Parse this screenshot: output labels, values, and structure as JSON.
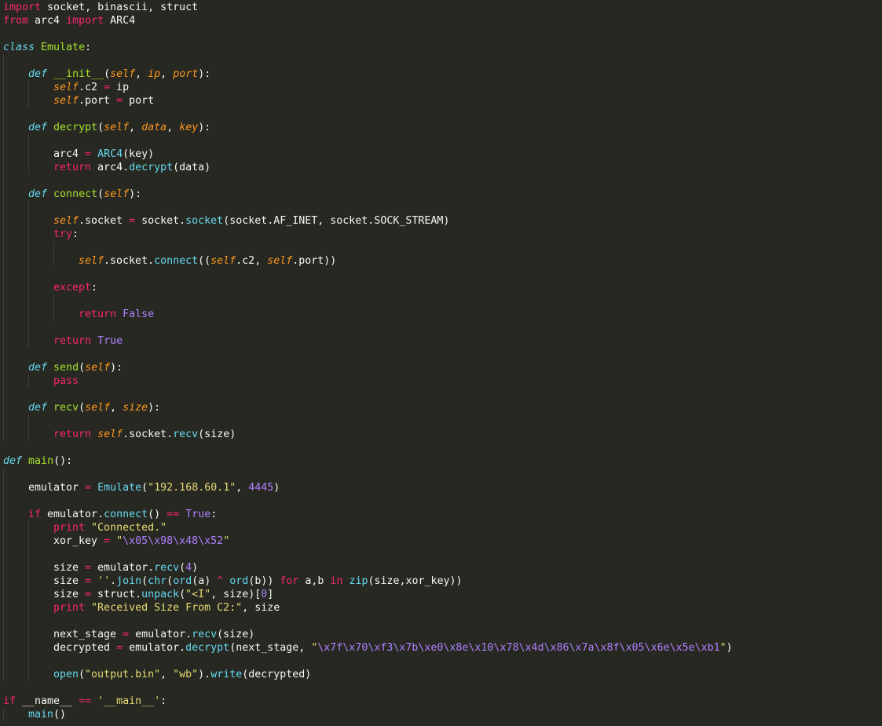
{
  "editor": {
    "theme": "monokai",
    "colors": {
      "background": "#272822",
      "foreground": "#f8f8f2",
      "keyword": "#f92672",
      "storage": "#66d9ef",
      "function": "#a6e22e",
      "parameter": "#fd971f",
      "string": "#e6db74",
      "constant": "#ae81ff",
      "indent_guide": "#3e3d32"
    },
    "lines": [
      {
        "indent": 0,
        "tokens": [
          [
            "keyword",
            "import"
          ],
          [
            "plain",
            " socket, binascii, struct"
          ]
        ]
      },
      {
        "indent": 0,
        "tokens": [
          [
            "keyword",
            "from"
          ],
          [
            "plain",
            " arc4 "
          ],
          [
            "keyword",
            "import"
          ],
          [
            "plain",
            " ARC4"
          ]
        ]
      },
      {
        "indent": 0,
        "tokens": []
      },
      {
        "indent": 0,
        "tokens": [
          [
            "storage",
            "class"
          ],
          [
            "plain",
            " "
          ],
          [
            "classname",
            "Emulate"
          ],
          [
            "plain",
            ":"
          ]
        ]
      },
      {
        "indent": 1,
        "tokens": []
      },
      {
        "indent": 1,
        "tokens": [
          [
            "storage",
            "def"
          ],
          [
            "plain",
            " "
          ],
          [
            "funcname",
            "__init__"
          ],
          [
            "plain",
            "("
          ],
          [
            "param",
            "self"
          ],
          [
            "plain",
            ", "
          ],
          [
            "param",
            "ip"
          ],
          [
            "plain",
            ", "
          ],
          [
            "param",
            "port"
          ],
          [
            "plain",
            "):"
          ]
        ]
      },
      {
        "indent": 2,
        "tokens": [
          [
            "self",
            "self"
          ],
          [
            "plain",
            ".c2 "
          ],
          [
            "op",
            "="
          ],
          [
            "plain",
            " ip"
          ]
        ]
      },
      {
        "indent": 2,
        "tokens": [
          [
            "self",
            "self"
          ],
          [
            "plain",
            ".port "
          ],
          [
            "op",
            "="
          ],
          [
            "plain",
            " port"
          ]
        ]
      },
      {
        "indent": 1,
        "tokens": []
      },
      {
        "indent": 1,
        "tokens": [
          [
            "storage",
            "def"
          ],
          [
            "plain",
            " "
          ],
          [
            "funcname",
            "decrypt"
          ],
          [
            "plain",
            "("
          ],
          [
            "param",
            "self"
          ],
          [
            "plain",
            ", "
          ],
          [
            "param",
            "data"
          ],
          [
            "plain",
            ", "
          ],
          [
            "param",
            "key"
          ],
          [
            "plain",
            "):"
          ]
        ]
      },
      {
        "indent": 2,
        "tokens": []
      },
      {
        "indent": 2,
        "tokens": [
          [
            "plain",
            "arc4 "
          ],
          [
            "op",
            "="
          ],
          [
            "plain",
            " "
          ],
          [
            "builtin",
            "ARC4"
          ],
          [
            "plain",
            "(key)"
          ]
        ]
      },
      {
        "indent": 2,
        "tokens": [
          [
            "keyword",
            "return"
          ],
          [
            "plain",
            " arc4."
          ],
          [
            "builtin",
            "decrypt"
          ],
          [
            "plain",
            "(data)"
          ]
        ]
      },
      {
        "indent": 1,
        "tokens": []
      },
      {
        "indent": 1,
        "tokens": [
          [
            "storage",
            "def"
          ],
          [
            "plain",
            " "
          ],
          [
            "funcname",
            "connect"
          ],
          [
            "plain",
            "("
          ],
          [
            "param",
            "self"
          ],
          [
            "plain",
            "):"
          ]
        ]
      },
      {
        "indent": 2,
        "tokens": []
      },
      {
        "indent": 2,
        "tokens": [
          [
            "self",
            "self"
          ],
          [
            "plain",
            ".socket "
          ],
          [
            "op",
            "="
          ],
          [
            "plain",
            " socket."
          ],
          [
            "builtin",
            "socket"
          ],
          [
            "plain",
            "(socket.AF_INET, socket.SOCK_STREAM)"
          ]
        ]
      },
      {
        "indent": 2,
        "tokens": [
          [
            "keyword",
            "try"
          ],
          [
            "plain",
            ":"
          ]
        ]
      },
      {
        "indent": 3,
        "tokens": []
      },
      {
        "indent": 3,
        "tokens": [
          [
            "self",
            "self"
          ],
          [
            "plain",
            ".socket."
          ],
          [
            "builtin",
            "connect"
          ],
          [
            "plain",
            "(("
          ],
          [
            "self",
            "self"
          ],
          [
            "plain",
            ".c2, "
          ],
          [
            "self",
            "self"
          ],
          [
            "plain",
            ".port))"
          ]
        ]
      },
      {
        "indent": 2,
        "tokens": []
      },
      {
        "indent": 2,
        "tokens": [
          [
            "keyword",
            "except"
          ],
          [
            "plain",
            ":"
          ]
        ]
      },
      {
        "indent": 3,
        "tokens": []
      },
      {
        "indent": 3,
        "tokens": [
          [
            "keyword",
            "return"
          ],
          [
            "plain",
            " "
          ],
          [
            "const",
            "False"
          ]
        ]
      },
      {
        "indent": 2,
        "tokens": []
      },
      {
        "indent": 2,
        "tokens": [
          [
            "keyword",
            "return"
          ],
          [
            "plain",
            " "
          ],
          [
            "const",
            "True"
          ]
        ]
      },
      {
        "indent": 1,
        "tokens": []
      },
      {
        "indent": 1,
        "tokens": [
          [
            "storage",
            "def"
          ],
          [
            "plain",
            " "
          ],
          [
            "funcname",
            "send"
          ],
          [
            "plain",
            "("
          ],
          [
            "param",
            "self"
          ],
          [
            "plain",
            "):"
          ]
        ]
      },
      {
        "indent": 2,
        "tokens": [
          [
            "keyword",
            "pass"
          ]
        ]
      },
      {
        "indent": 1,
        "tokens": []
      },
      {
        "indent": 1,
        "tokens": [
          [
            "storage",
            "def"
          ],
          [
            "plain",
            " "
          ],
          [
            "funcname",
            "recv"
          ],
          [
            "plain",
            "("
          ],
          [
            "param",
            "self"
          ],
          [
            "plain",
            ", "
          ],
          [
            "param",
            "size"
          ],
          [
            "plain",
            "):"
          ]
        ]
      },
      {
        "indent": 2,
        "tokens": []
      },
      {
        "indent": 2,
        "tokens": [
          [
            "keyword",
            "return"
          ],
          [
            "plain",
            " "
          ],
          [
            "self",
            "self"
          ],
          [
            "plain",
            ".socket."
          ],
          [
            "builtin",
            "recv"
          ],
          [
            "plain",
            "(size)"
          ]
        ]
      },
      {
        "indent": 0,
        "tokens": []
      },
      {
        "indent": 0,
        "tokens": [
          [
            "storage",
            "def"
          ],
          [
            "plain",
            " "
          ],
          [
            "funcname",
            "main"
          ],
          [
            "plain",
            "():"
          ]
        ]
      },
      {
        "indent": 1,
        "tokens": []
      },
      {
        "indent": 1,
        "tokens": [
          [
            "plain",
            "emulator "
          ],
          [
            "op",
            "="
          ],
          [
            "plain",
            " "
          ],
          [
            "builtin",
            "Emulate"
          ],
          [
            "plain",
            "("
          ],
          [
            "string",
            "\"192.168.60.1\""
          ],
          [
            "plain",
            ", "
          ],
          [
            "const",
            "4445"
          ],
          [
            "plain",
            ")"
          ]
        ]
      },
      {
        "indent": 1,
        "tokens": []
      },
      {
        "indent": 1,
        "tokens": [
          [
            "keyword",
            "if"
          ],
          [
            "plain",
            " emulator."
          ],
          [
            "builtin",
            "connect"
          ],
          [
            "plain",
            "() "
          ],
          [
            "op",
            "=="
          ],
          [
            "plain",
            " "
          ],
          [
            "const",
            "True"
          ],
          [
            "plain",
            ":"
          ]
        ]
      },
      {
        "indent": 2,
        "tokens": [
          [
            "keyword",
            "print"
          ],
          [
            "plain",
            " "
          ],
          [
            "string",
            "\"Connected.\""
          ]
        ]
      },
      {
        "indent": 2,
        "tokens": [
          [
            "plain",
            "xor_key "
          ],
          [
            "op",
            "="
          ],
          [
            "plain",
            " "
          ],
          [
            "string",
            "\""
          ],
          [
            "escape",
            "\\x05\\x98\\x48\\x52"
          ],
          [
            "string",
            "\""
          ]
        ]
      },
      {
        "indent": 2,
        "tokens": []
      },
      {
        "indent": 2,
        "tokens": [
          [
            "plain",
            "size "
          ],
          [
            "op",
            "="
          ],
          [
            "plain",
            " emulator."
          ],
          [
            "builtin",
            "recv"
          ],
          [
            "plain",
            "("
          ],
          [
            "const",
            "4"
          ],
          [
            "plain",
            ")"
          ]
        ]
      },
      {
        "indent": 2,
        "tokens": [
          [
            "plain",
            "size "
          ],
          [
            "op",
            "="
          ],
          [
            "plain",
            " "
          ],
          [
            "string",
            "''"
          ],
          [
            "plain",
            "."
          ],
          [
            "builtin",
            "join"
          ],
          [
            "plain",
            "("
          ],
          [
            "builtin",
            "chr"
          ],
          [
            "plain",
            "("
          ],
          [
            "builtin",
            "ord"
          ],
          [
            "plain",
            "(a) "
          ],
          [
            "op",
            "^"
          ],
          [
            "plain",
            " "
          ],
          [
            "builtin",
            "ord"
          ],
          [
            "plain",
            "(b)) "
          ],
          [
            "keyword",
            "for"
          ],
          [
            "plain",
            " a,b "
          ],
          [
            "keyword",
            "in"
          ],
          [
            "plain",
            " "
          ],
          [
            "builtin",
            "zip"
          ],
          [
            "plain",
            "(size,xor_key))"
          ]
        ]
      },
      {
        "indent": 2,
        "tokens": [
          [
            "plain",
            "size "
          ],
          [
            "op",
            "="
          ],
          [
            "plain",
            " struct."
          ],
          [
            "builtin",
            "unpack"
          ],
          [
            "plain",
            "("
          ],
          [
            "string",
            "\"<I\""
          ],
          [
            "plain",
            ", size)["
          ],
          [
            "const",
            "0"
          ],
          [
            "plain",
            "]"
          ]
        ]
      },
      {
        "indent": 2,
        "tokens": [
          [
            "keyword",
            "print"
          ],
          [
            "plain",
            " "
          ],
          [
            "string",
            "\"Received Size From C2:\""
          ],
          [
            "plain",
            ", size"
          ]
        ]
      },
      {
        "indent": 2,
        "tokens": []
      },
      {
        "indent": 2,
        "tokens": [
          [
            "plain",
            "next_stage "
          ],
          [
            "op",
            "="
          ],
          [
            "plain",
            " emulator."
          ],
          [
            "builtin",
            "recv"
          ],
          [
            "plain",
            "(size)"
          ]
        ]
      },
      {
        "indent": 2,
        "tokens": [
          [
            "plain",
            "decrypted "
          ],
          [
            "op",
            "="
          ],
          [
            "plain",
            " emulator."
          ],
          [
            "builtin",
            "decrypt"
          ],
          [
            "plain",
            "(next_stage, "
          ],
          [
            "string",
            "\""
          ],
          [
            "escape",
            "\\x7f\\x70\\xf3\\x7b\\xe0\\x8e\\x10\\x78\\x4d\\x86\\x7a\\x8f\\x05\\x6e\\x5e\\xb1"
          ],
          [
            "string",
            "\""
          ],
          [
            "plain",
            ")"
          ]
        ]
      },
      {
        "indent": 2,
        "tokens": []
      },
      {
        "indent": 2,
        "tokens": [
          [
            "builtin",
            "open"
          ],
          [
            "plain",
            "("
          ],
          [
            "string",
            "\"output.bin\""
          ],
          [
            "plain",
            ", "
          ],
          [
            "string",
            "\"wb\""
          ],
          [
            "plain",
            ")."
          ],
          [
            "builtin",
            "write"
          ],
          [
            "plain",
            "(decrypted)"
          ]
        ]
      },
      {
        "indent": 0,
        "tokens": []
      },
      {
        "indent": 0,
        "tokens": [
          [
            "keyword",
            "if"
          ],
          [
            "plain",
            " __name__ "
          ],
          [
            "op",
            "=="
          ],
          [
            "plain",
            " "
          ],
          [
            "string",
            "'__main__'"
          ],
          [
            "plain",
            ":"
          ]
        ]
      },
      {
        "indent": 1,
        "tokens": [
          [
            "builtin",
            "main"
          ],
          [
            "plain",
            "()"
          ]
        ]
      }
    ]
  }
}
